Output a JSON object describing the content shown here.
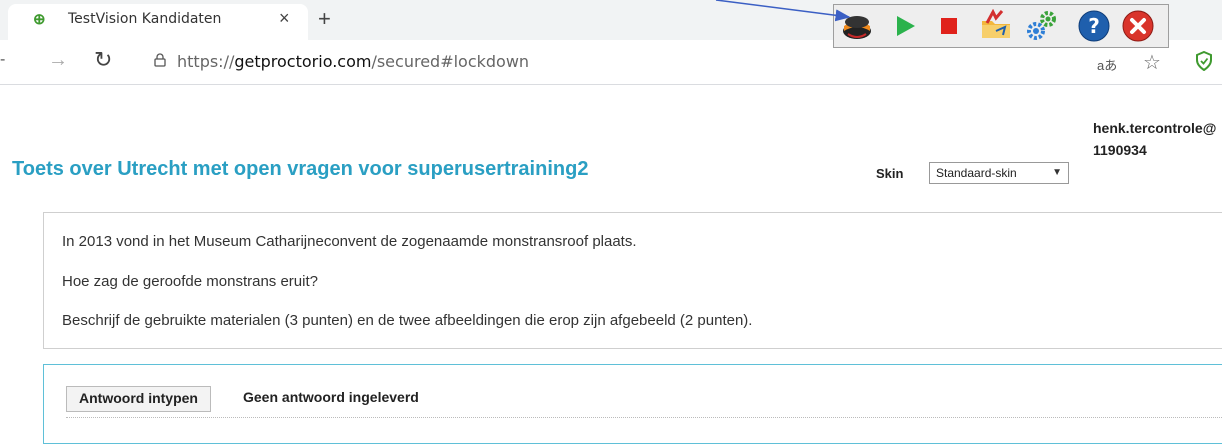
{
  "browser": {
    "tab_title": "TestVision Kandidaten",
    "tab_close": "×",
    "new_tab": "+",
    "url_scheme": "https://",
    "url_host": "getproctorio.com",
    "url_path": "/secured#lockdown",
    "translate_label": "aあ"
  },
  "proctorio_toolbar": {
    "buttons": [
      "graduation-cap",
      "play",
      "stop",
      "folder-share",
      "settings",
      "help",
      "close"
    ],
    "colors": {
      "play": "#2bb24c",
      "stop": "#e0221b",
      "help": "#1f5fad",
      "close": "#d9342b"
    }
  },
  "page": {
    "title": "Toets over Utrecht met open vragen voor superusertraining2",
    "skin_label": "Skin",
    "skin_value": "Standaard-skin",
    "user_name": "henk.tercontrole@",
    "user_id": "1190934"
  },
  "question": {
    "lines": [
      "In 2013 vond in het Museum Catharijneconvent de zogenaamde monstransroof plaats.",
      "Hoe zag de geroofde monstrans eruit?",
      "Beschrijf de gebruikte materialen (3 punten) en de twee afbeeldingen die erop zijn afgebeeld (2 punten)."
    ]
  },
  "answer": {
    "button_label": "Antwoord intypen",
    "status": "Geen antwoord ingeleverd"
  },
  "colors": {
    "title": "#2a9fc3",
    "answer_border": "#5fc0d8"
  }
}
